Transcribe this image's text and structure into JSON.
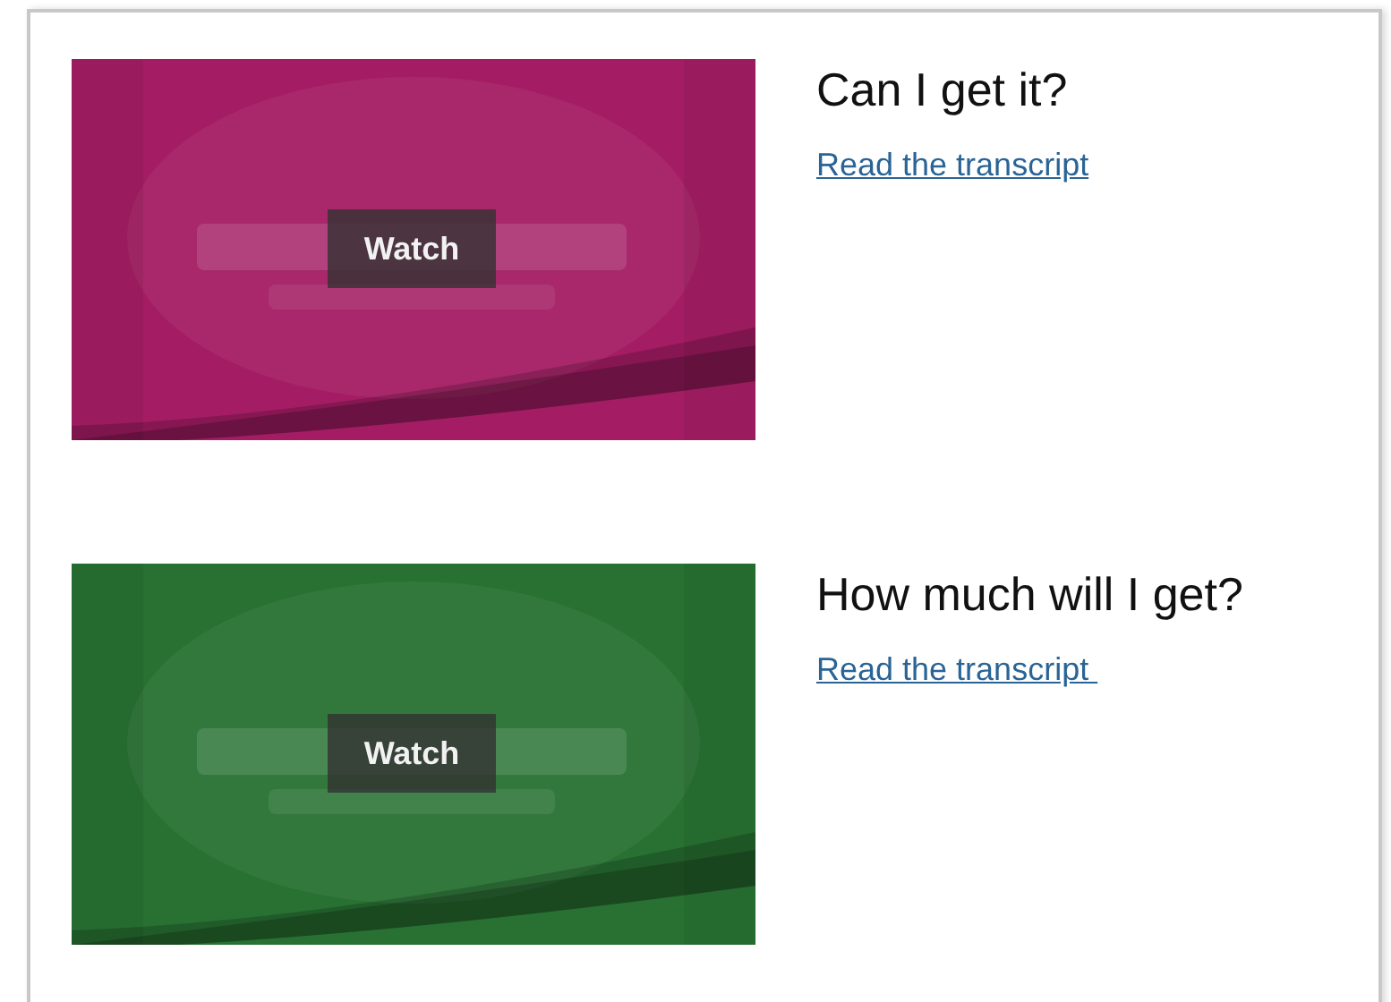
{
  "videos": [
    {
      "title": "Can I get it?",
      "link": "Read the transcript",
      "button": "Watch"
    },
    {
      "title": "How much will I get?",
      "link": "Read the transcript ",
      "button": "Watch"
    }
  ]
}
